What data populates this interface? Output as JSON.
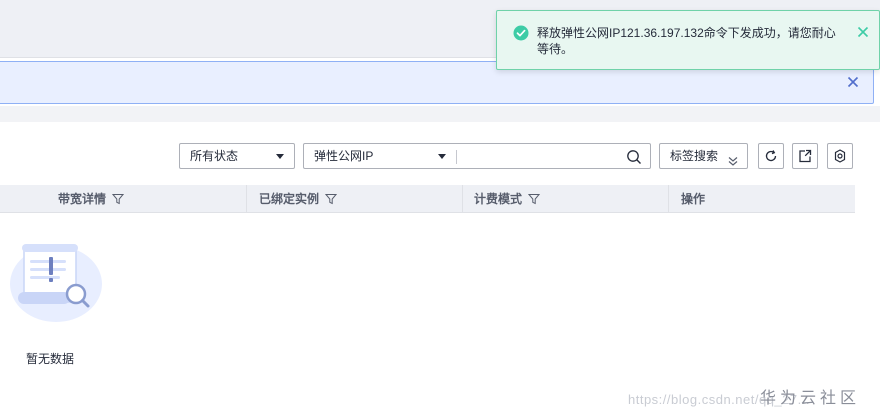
{
  "toast": {
    "message": "释放弹性公网IP121.36.197.132命令下发成功，请您耐心等待。",
    "close_icon": "close-icon",
    "status_icon": "check-circle-icon",
    "accent": "#19be6b"
  },
  "banner": {
    "close_icon": "close-icon",
    "border_color": "#8fb0f5"
  },
  "filters": {
    "status_select": "所有状态",
    "field_select": "弹性公网IP",
    "search_value": "",
    "tag_search_label": "标签搜索"
  },
  "toolbar_icons": [
    "refresh-icon",
    "export-icon",
    "settings-icon"
  ],
  "table": {
    "columns": [
      {
        "label": "带宽详情",
        "filter": true
      },
      {
        "label": "已绑定实例",
        "filter": true
      },
      {
        "label": "计费模式",
        "filter": true
      },
      {
        "label": "操作",
        "filter": false
      }
    ],
    "rows": []
  },
  "empty_state": {
    "text": "暂无数据"
  },
  "watermark": {
    "brand": "华为云社区",
    "url": "https://blog.csdn.net/qq_27..."
  }
}
